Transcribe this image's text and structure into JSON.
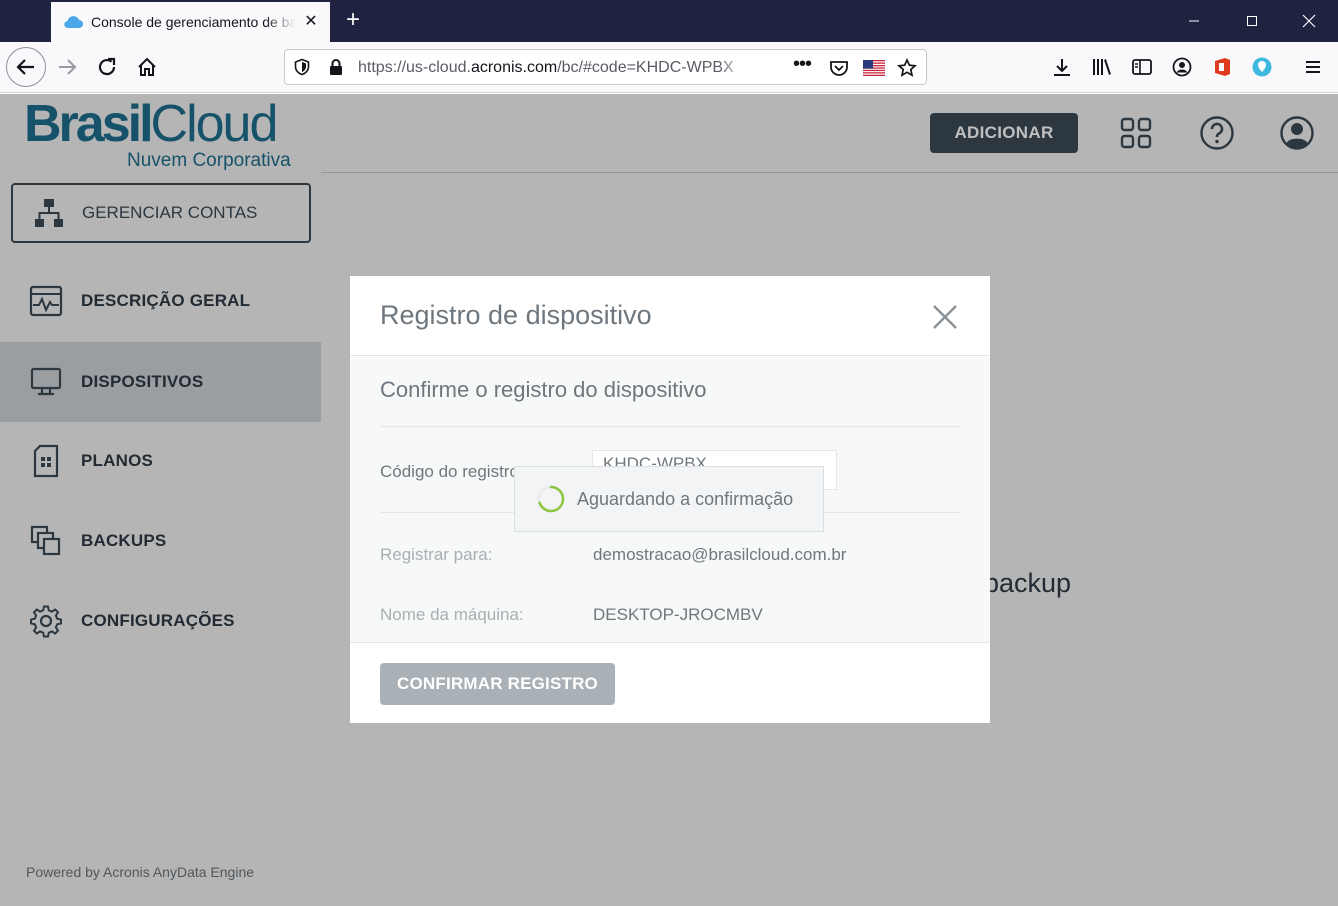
{
  "browser": {
    "tab_title": "Console de gerenciamento de backup",
    "url_prefix": "https://us-cloud.",
    "url_domain": "acronis.com",
    "url_path": "/bc/#code=KHDC-WPBX"
  },
  "app": {
    "logo_main_bold": "Brasil",
    "logo_main_thin": "Cloud",
    "logo_sub": "Nuvem Corporativa",
    "manage_accounts": "GERENCIAR CONTAS",
    "sidebar": {
      "items": [
        {
          "label": "DESCRIÇÃO GERAL",
          "icon": "activity-monitor-icon"
        },
        {
          "label": "DISPOSITIVOS",
          "icon": "desktop-icon",
          "active": true
        },
        {
          "label": "PLANOS",
          "icon": "plan-icon"
        },
        {
          "label": "BACKUPS",
          "icon": "copies-icon"
        },
        {
          "label": "CONFIGURAÇÕES",
          "icon": "gear-icon"
        }
      ]
    },
    "powered_by": "Powered by Acronis AnyData Engine",
    "header": {
      "add_label": "ADICIONAR"
    },
    "background_text": "backup"
  },
  "modal": {
    "title": "Registro de dispositivo",
    "subtitle": "Confirme o registro do dispositivo",
    "code_label": "Código do registro:",
    "code_value": "KHDC-WPBX",
    "waiting_text": "Aguardando a confirmação",
    "register_for_label": "Registrar para:",
    "register_for_value": "demostracao@brasilcloud.com.br",
    "machine_label": "Nome da máquina:",
    "machine_value": "DESKTOP-JROCMBV",
    "confirm_label": "CONFIRMAR REGISTRO"
  },
  "colors": {
    "titlebar": "#202340",
    "brand": "#1e6e8c",
    "dark_slate": "#3d4a55",
    "active_item": "#cfd3d6"
  }
}
